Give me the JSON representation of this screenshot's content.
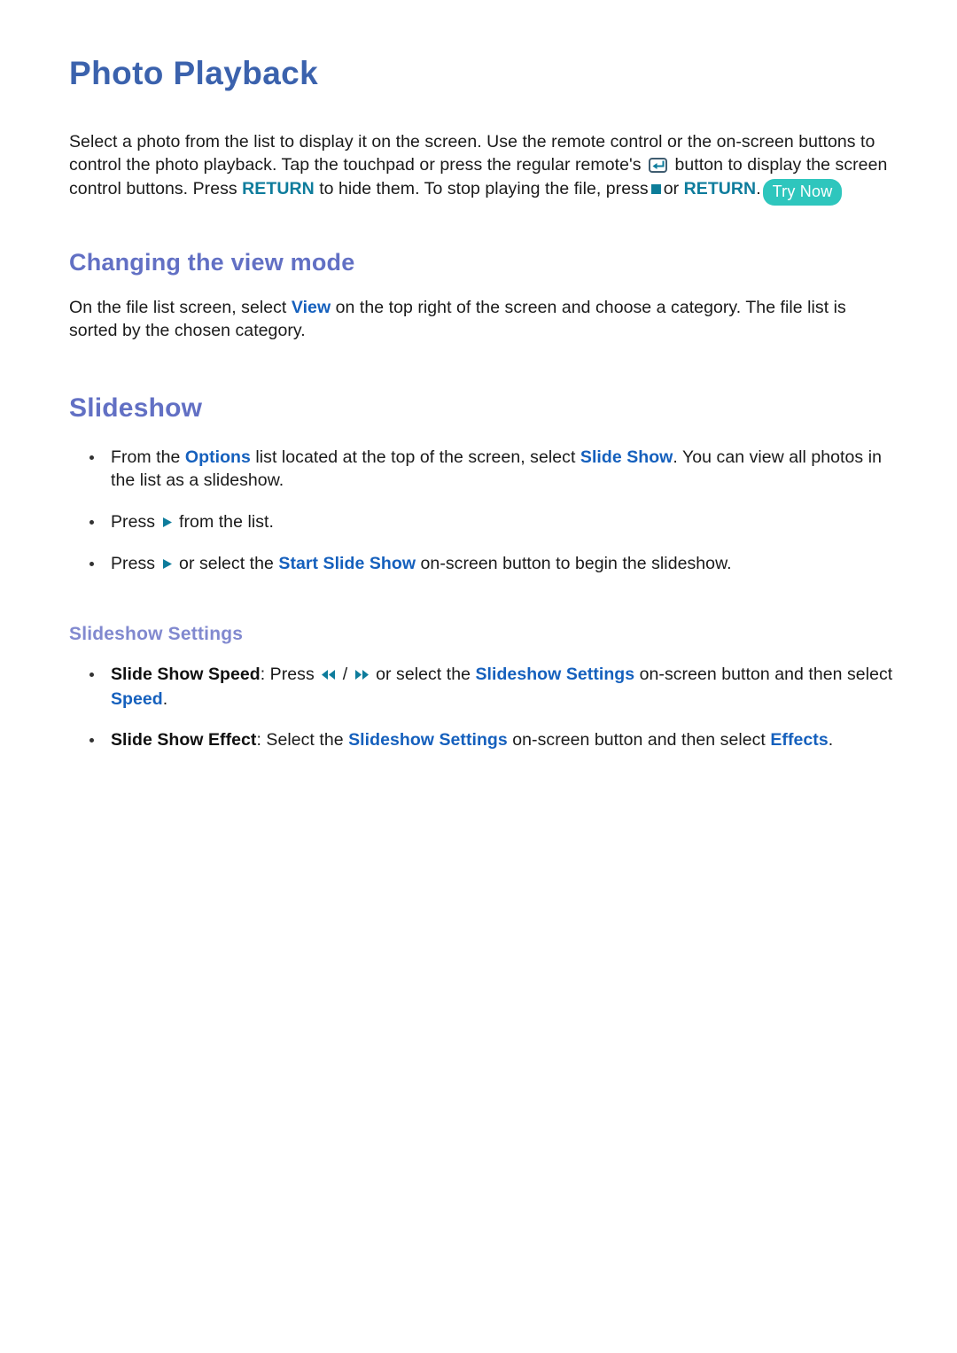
{
  "page": {
    "title": "Photo Playback",
    "intro": {
      "part1": "Select a photo from the list to display it on the screen. Use the remote control or the on-screen buttons to control the photo playback. Tap the touchpad or press the regular remote's",
      "part2": "button to display the screen control buttons. Press",
      "kw_return_1": "RETURN",
      "part3": "to hide them. To stop playing the file, press",
      "part4": "or",
      "kw_return_2": "RETURN",
      "part5": ".",
      "badge_try_now": "Try Now"
    },
    "sections": [
      {
        "heading": "Changing the view mode",
        "paragraph": {
          "part1": "On the file list screen, select",
          "kw_view": "View",
          "part2": "on the top right of the screen and choose a category. The file list is sorted by the chosen category."
        }
      },
      {
        "heading": "Slideshow",
        "bullets": [
          {
            "part1": "From the",
            "kw1": "Options",
            "part2": "list located at the top of the screen, select",
            "kw2": "Slide Show",
            "part3": ". You can view all photos in the list as a slideshow."
          },
          {
            "part1": "Press",
            "icon": "play-icon",
            "part2": "from the list."
          },
          {
            "part1": "Press",
            "icon": "play-icon",
            "part2": "or select the",
            "kw1": "Start Slide Show",
            "part3": "on-screen button to begin the slideshow."
          }
        ],
        "sub_heading": "Slideshow Settings",
        "sub_bullets": [
          {
            "label": "Slide Show Speed",
            "part1": ": Press",
            "icon1": "rewind-icon",
            "separator": "/",
            "icon2": "fast-forward-icon",
            "part2": "or select the",
            "kw1": "Slideshow Settings",
            "part3": "on-screen button and then select",
            "kw2": "Speed",
            "part4": "."
          },
          {
            "label": "Slide Show Effect",
            "part1": ": Select the",
            "kw1": "Slideshow Settings",
            "part2": "on-screen button and then select",
            "kw2": "Effects",
            "part3": "."
          }
        ]
      }
    ],
    "colors": {
      "title_blue": "#3b62ad",
      "heading_purple": "#6270c4",
      "subheading_purple": "#8189cf",
      "keyword_blue": "#1560bd",
      "keyword_teal": "#0e7c9c",
      "badge_teal": "#2ec6bd",
      "body_black": "#1a1a1a"
    }
  }
}
